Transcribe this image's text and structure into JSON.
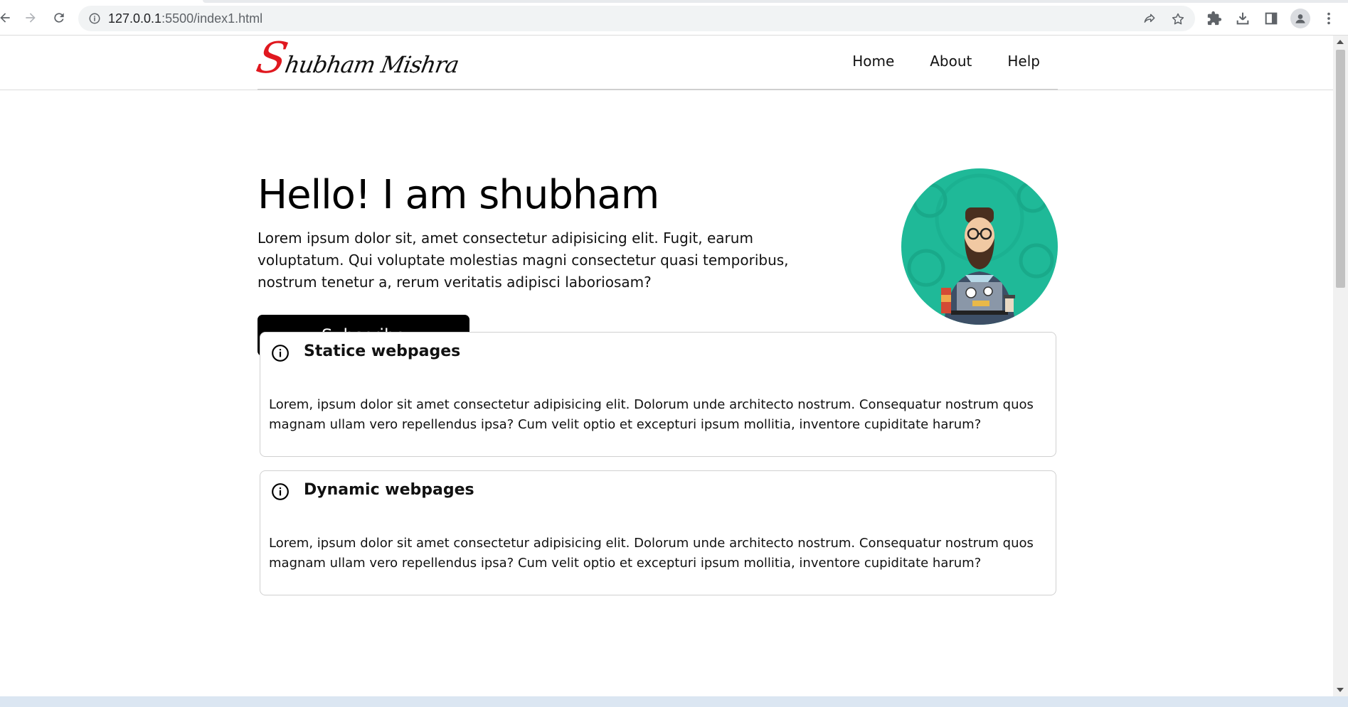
{
  "browser": {
    "url_host": "127.0.0.1",
    "url_rest": ":5500/index1.html"
  },
  "logo": {
    "initial": "S",
    "rest": "hubham Mishra"
  },
  "nav": {
    "items": [
      "Home",
      "About",
      "Help"
    ]
  },
  "hero": {
    "title": "Hello! I am shubham",
    "text": "Lorem ipsum dolor sit, amet consectetur adipisicing elit. Fugit, earum voluptatum. Qui voluptate molestias magni consectetur quasi temporibus, nostrum tenetur a, rerum veritatis adipisci laboriosam?",
    "button": "Subscribe",
    "image_bg": "#1fb998"
  },
  "cards": [
    {
      "title": "Statice webpages",
      "body": "Lorem, ipsum dolor sit amet consectetur adipisicing elit. Dolorum unde architecto nostrum. Consequatur nostrum quos magnam ullam vero repellendus ipsa? Cum velit optio et excepturi ipsum mollitia, inventore cupiditate harum?"
    },
    {
      "title": "Dynamic webpages",
      "body": "Lorem, ipsum dolor sit amet consectetur adipisicing elit. Dolorum unde architecto nostrum. Consequatur nostrum quos magnam ullam vero repellendus ipsa? Cum velit optio et excepturi ipsum mollitia, inventore cupiditate harum?"
    }
  ],
  "colors": {
    "logo_accent": "#e0181f",
    "button_bg": "#000000"
  }
}
